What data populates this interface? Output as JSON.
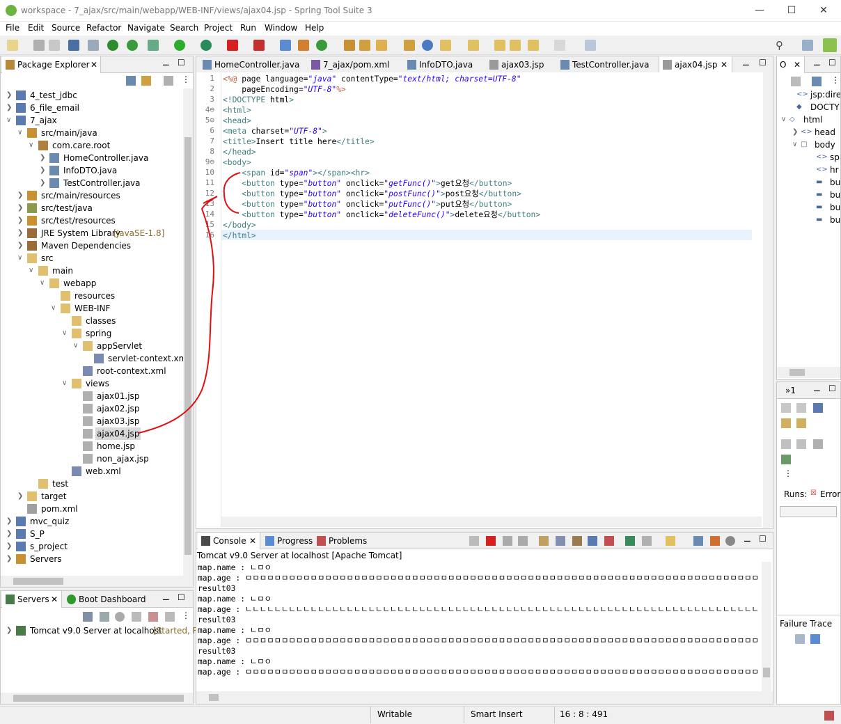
{
  "window": {
    "title": "workspace - 7_ajax/src/main/webapp/WEB-INF/views/ajax04.jsp - Spring Tool Suite 3"
  },
  "menu": [
    "File",
    "Edit",
    "Source",
    "Refactor",
    "Navigate",
    "Search",
    "Project",
    "Run",
    "Window",
    "Help"
  ],
  "explorer": {
    "tab_label": "Package Explorer",
    "tree": [
      {
        "label": "4_test_jdbc"
      },
      {
        "label": "6_file_email"
      },
      {
        "label": "7_ajax"
      },
      {
        "label": "src/main/java"
      },
      {
        "label": "com.care.root"
      },
      {
        "label": "HomeController.java"
      },
      {
        "label": "InfoDTO.java"
      },
      {
        "label": "TestController.java"
      },
      {
        "label": "src/main/resources"
      },
      {
        "label": "src/test/java"
      },
      {
        "label": "src/test/resources"
      },
      {
        "label": "JRE System Library",
        "suffix": "[JavaSE-1.8]"
      },
      {
        "label": "Maven Dependencies"
      },
      {
        "label": "src"
      },
      {
        "label": "main"
      },
      {
        "label": "webapp"
      },
      {
        "label": "resources"
      },
      {
        "label": "WEB-INF"
      },
      {
        "label": "classes"
      },
      {
        "label": "spring"
      },
      {
        "label": "appServlet"
      },
      {
        "label": "servlet-context.xml"
      },
      {
        "label": "root-context.xml"
      },
      {
        "label": "views"
      },
      {
        "label": "ajax01.jsp"
      },
      {
        "label": "ajax02.jsp"
      },
      {
        "label": "ajax03.jsp"
      },
      {
        "label": "ajax04.jsp"
      },
      {
        "label": "home.jsp"
      },
      {
        "label": "non_ajax.jsp"
      },
      {
        "label": "web.xml"
      },
      {
        "label": "test"
      },
      {
        "label": "target"
      },
      {
        "label": "pom.xml"
      },
      {
        "label": "mvc_quiz"
      },
      {
        "label": "S_P"
      },
      {
        "label": "s_project"
      },
      {
        "label": "Servers"
      }
    ]
  },
  "servers": {
    "tab1": "Servers",
    "tab2": "Boot Dashboard",
    "item": "Tomcat v9.0 Server at localhost",
    "item_status": "[Started, R"
  },
  "editor_tabs": [
    "HomeController.java",
    "7_ajax/pom.xml",
    "InfoDTO.java",
    "ajax03.jsp",
    "TestController.java",
    "ajax04.jsp"
  ],
  "code": [
    {
      "n": "1",
      "t": "<%@ page language=\"java\" contentType=\"text/html; charset=UTF-8\""
    },
    {
      "n": "2",
      "t": "    pageEncoding=\"UTF-8\"%>"
    },
    {
      "n": "3",
      "t": "<!DOCTYPE html>"
    },
    {
      "n": "4⊖",
      "t": "<html>"
    },
    {
      "n": "5⊖",
      "t": "<head>"
    },
    {
      "n": "6",
      "t": "<meta charset=\"UTF-8\">"
    },
    {
      "n": "7",
      "t": "<title>Insert title here</title>"
    },
    {
      "n": "8",
      "t": "</head>"
    },
    {
      "n": "9⊖",
      "t": "<body>"
    },
    {
      "n": "10",
      "t": "    <span id=\"span\"></span><hr>"
    },
    {
      "n": "11",
      "t": "    <button type=\"button\" onclick=\"getFunc()\">get요청</button>"
    },
    {
      "n": "12",
      "t": "    <button type=\"button\" onclick=\"postFunc()\">post요청</button>"
    },
    {
      "n": "13",
      "t": "    <button type=\"button\" onclick=\"putFunc()\">put요청</button>"
    },
    {
      "n": "14",
      "t": "    <button type=\"button\" onclick=\"deleteFunc()\">delete요청</button>"
    },
    {
      "n": "15",
      "t": "</body>"
    },
    {
      "n": "16",
      "t": "</html>"
    }
  ],
  "outline": {
    "tab_label": "O",
    "items": [
      "jsp:directi",
      "DOCTYPE",
      "html",
      "head",
      "body",
      "spa",
      "hr",
      "but",
      "but",
      "but",
      "but"
    ]
  },
  "junit": {
    "tab_label": "»1",
    "runs_label": "Runs:",
    "errors_label": "Error",
    "failure_trace": "Failure Trace"
  },
  "console": {
    "tabs": [
      "Console",
      "Progress",
      "Problems"
    ],
    "header": "Tomcat v9.0 Server at localhost [Apache Tomcat]",
    "lines": [
      "map.name : ㄴㅁㅇ",
      "map.age : ㅁㅁㅁㅁㅁㅁㅁㅁㅁㅁㅁㅁㅁㅁㅁㅁㅁㅁㅁㅁㅁㅁㅁㅁㅁㅁㅁㅁㅁㅁㅁㅁㅁㅁㅁㅁㅁㅁㅁㅁㅁㅁㅁㅁㅁㅁㅁㅁㅁㅁㅁㅁㅁㅁㅁㅁㅁㅁㅁㅁㅁㅁㅁㅁㅁㅁㅁㅁㅁㅁㅁ",
      "result03",
      "map.name : ㄴㅁㅇ",
      "map.age : ㄴㄴㄴㄴㄴㄴㄴㄴㄴㄴㄴㄴㄴㄴㄴㄴㄴㄴㄴㄴㄴㄴㄴㄴㄴㄴㄴㄴㄴㄴㄴㄴㄴㄴㄴㄴㄴㄴㄴㄴㄴㄴㄴㄴㄴㄴㄴㄴㄴㄴㄴㄴㄴㄴㄴㄴㄴㄴㄴㄴㄴㄴㄴㄴㄴㄴㄴㄴㄴㄴㄴ",
      "result03",
      "map.name : ㄴㅁㅇ",
      "map.age : ㅁㅁㅁㅁㅁㅁㅁㅁㅁㅁㅁㅁㅁㅁㅁㅁㅁㅁㅁㅁㅁㅁㅁㅁㅁㅁㅁㅁㅁㅁㅁㅁㅁㅁㅁㅁㅁㅁㅁㅁㅁㅁㅁㅁㅁㅁㅁㅁㅁㅁㅁㅁㅁㅁㅁㅁㅁㅁㅁㅁㅁㅁㅁㅁㅁㅁㅁㅁㅁㅁㅁ",
      "result03",
      "map.name : ㄴㅁㅇ",
      "map.age : ㅁㅁㅁㅁㅁㅁㅁㅁㅁㅁㅁㅁㅁㅁㅁㅁㅁㅁㅁㅁㅁㅁㅁㅁㅁㅁㅁㅁㅁㅁㅁㅁㅁㅁㅁㅁㅁㅁㅁㅁㅁㅁㅁㅁㅁㅁㅁㅁㅁㅁㅁㅁㅁㅁㅁㅁㅁㅁㅁㅁㅁㅁㅁㅁㅁㅁㅁㅁㅁㅁㅁ"
    ]
  },
  "status": {
    "writable": "Writable",
    "insert_mode": "Smart Insert",
    "position": "16 : 8 : 491"
  },
  "colors": {
    "tag": "#3f7f7f",
    "attr": "#7f007f",
    "value": "#2a00ff",
    "annotation": "#c00000"
  }
}
